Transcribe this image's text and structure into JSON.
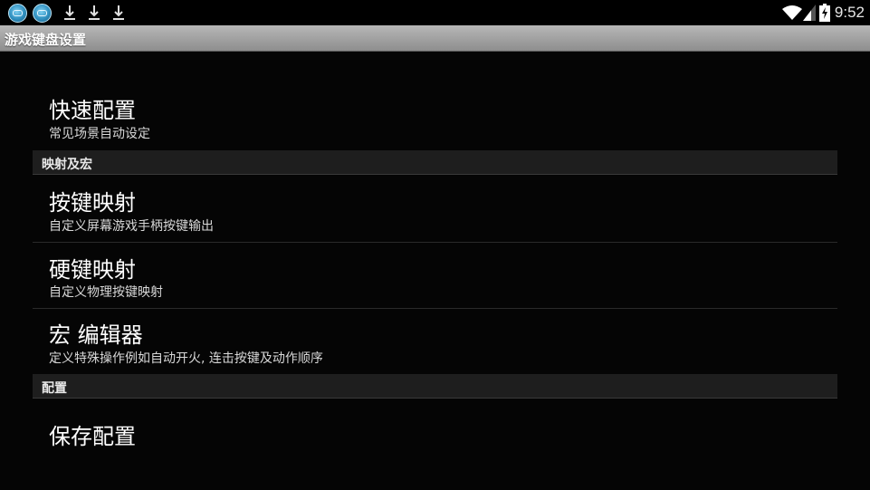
{
  "status_bar": {
    "left_icons": [
      "app-icon",
      "app-icon",
      "download-icon",
      "download-icon",
      "download-icon"
    ],
    "right_icons": [
      "wifi-icon",
      "signal-icon",
      "battery-icon"
    ],
    "time": "9:52"
  },
  "title_bar": {
    "title": "游戏键盘设置"
  },
  "list": {
    "quick_config": {
      "title": "快速配置",
      "summary": "常见场景自动设定"
    },
    "category_mapping": {
      "label": "映射及宏"
    },
    "key_mapping": {
      "title": "按键映射",
      "summary": "自定义屏幕游戏手柄按键输出"
    },
    "hard_key_mapping": {
      "title": "硬键映射",
      "summary": "自定义物理按键映射"
    },
    "macro_editor": {
      "title": "宏 编辑器",
      "summary": "定义特殊操作例如自动开火, 连击按键及动作顺序"
    },
    "category_config": {
      "label": "配置"
    },
    "save_config": {
      "title": "保存配置"
    }
  }
}
